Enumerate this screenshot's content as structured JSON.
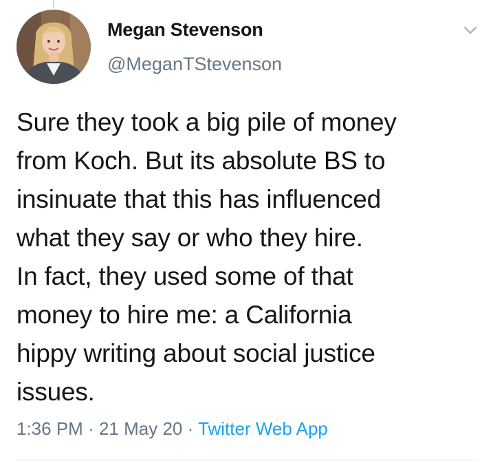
{
  "tweet": {
    "author": {
      "display_name": "Megan Stevenson",
      "handle": "@MeganTStevenson",
      "avatar_icon": "profile-photo"
    },
    "caret_icon": "chevron-down-icon",
    "text": "Sure they took a big pile of money\nfrom Koch. But its absolute BS to\ninsinuate that this has influenced\nwhat they say or who they hire.\nIn fact, they used some of that\nmoney to hire me: a California\nhippy writing about social justice\nissues.",
    "time": "1:36 PM",
    "separator": "·",
    "date": "21 May 20",
    "source": "Twitter Web App"
  },
  "colors": {
    "text_primary": "#14171a",
    "text_secondary": "#657786",
    "link": "#1da1f2",
    "divider": "#e1e8ed"
  }
}
